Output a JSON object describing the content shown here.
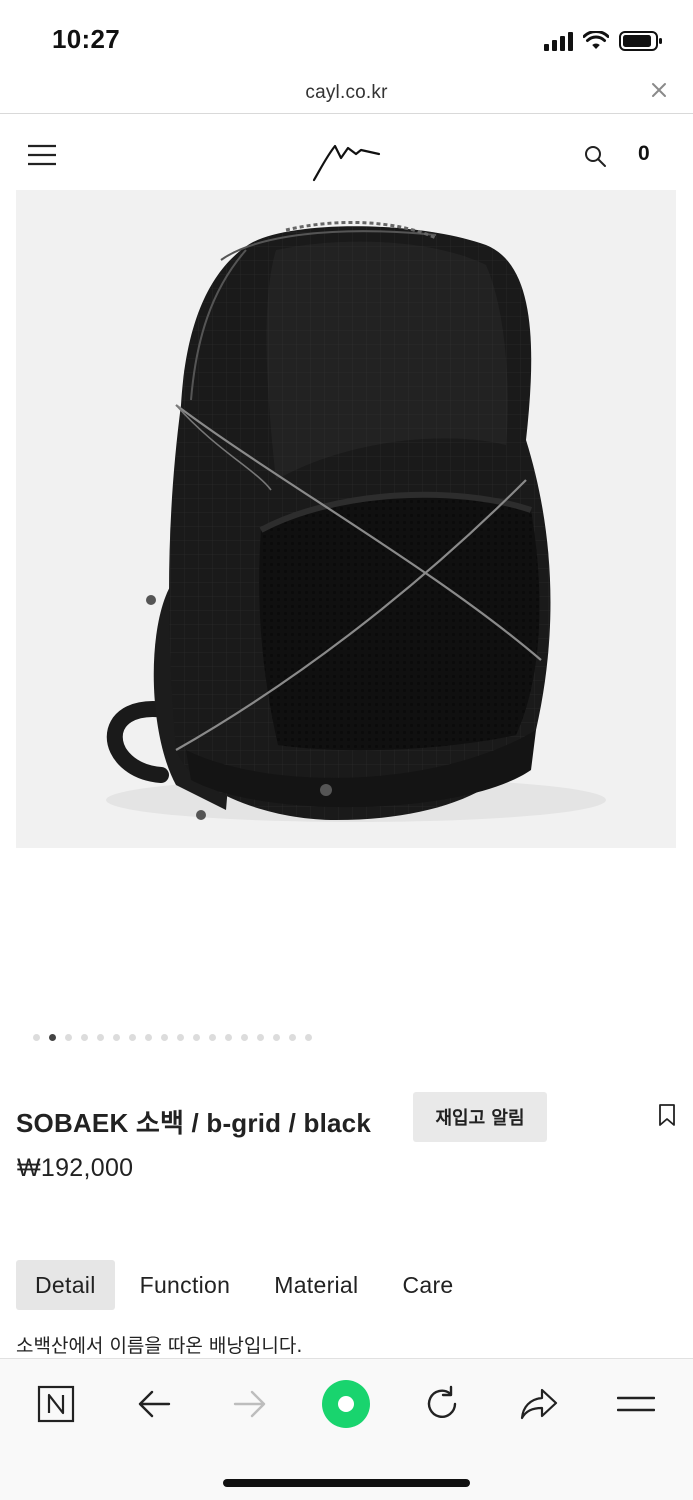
{
  "status_bar": {
    "time": "10:27"
  },
  "browser": {
    "url": "cayl.co.kr"
  },
  "header": {
    "cart_count": "0"
  },
  "carousel": {
    "total": 18,
    "active_index": 1
  },
  "product": {
    "title": "SOBAEK 소백 / b-grid / black",
    "price": "₩192,000",
    "restock_label": "재입고 알림"
  },
  "tabs": [
    {
      "label": "Detail",
      "active": true
    },
    {
      "label": "Function",
      "active": false
    },
    {
      "label": "Material",
      "active": false
    },
    {
      "label": "Care",
      "active": false
    }
  ],
  "description": "소백산에서 이름을 따온 배낭입니다.",
  "colors": {
    "accent_green": "#19d46e",
    "tab_active_bg": "#e6e6e6"
  },
  "toolbar": {
    "icons": [
      "naver-home-icon",
      "back-arrow-icon",
      "forward-arrow-icon",
      "green-dot-icon",
      "reload-icon",
      "share-icon",
      "menu-icon"
    ]
  }
}
